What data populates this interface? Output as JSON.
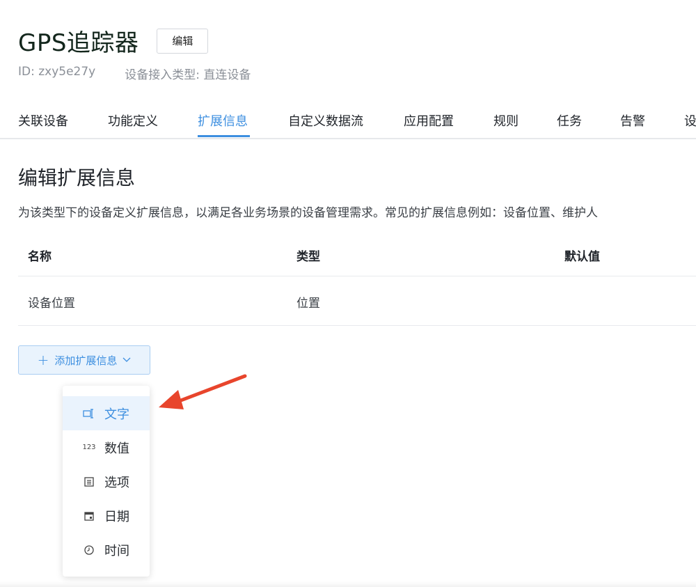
{
  "header": {
    "title": "GPS追踪器",
    "edit_label": "编辑",
    "id_text": "ID: zxy5e27y",
    "access_type_text": "设备接入类型: 直连设备"
  },
  "tabs": [
    {
      "label": "关联设备"
    },
    {
      "label": "功能定义"
    },
    {
      "label": "扩展信息",
      "active": true
    },
    {
      "label": "自定义数据流"
    },
    {
      "label": "应用配置"
    },
    {
      "label": "规则"
    },
    {
      "label": "任务"
    },
    {
      "label": "告警"
    },
    {
      "label": "设"
    }
  ],
  "section": {
    "title": "编辑扩展信息",
    "description": "为该类型下的设备定义扩展信息，以满足各业务场景的设备管理需求。常见的扩展信息例如：设备位置、维护人"
  },
  "table": {
    "headers": {
      "name": "名称",
      "type": "类型",
      "default": "默认值"
    },
    "rows": [
      {
        "name": "设备位置",
        "type": "位置",
        "default": ""
      }
    ]
  },
  "add_button": {
    "plus": "+",
    "label": "添加扩展信息"
  },
  "dropdown": {
    "items": [
      {
        "label": "文字",
        "icon": "text-field-icon",
        "active": true
      },
      {
        "label": "数值",
        "icon": "number-icon",
        "icon_text": "123"
      },
      {
        "label": "选项",
        "icon": "list-icon"
      },
      {
        "label": "日期",
        "icon": "calendar-icon"
      },
      {
        "label": "时间",
        "icon": "clock-icon"
      }
    ]
  },
  "colors": {
    "accent": "#3d8fe0",
    "annotation_arrow": "#e8452c"
  }
}
